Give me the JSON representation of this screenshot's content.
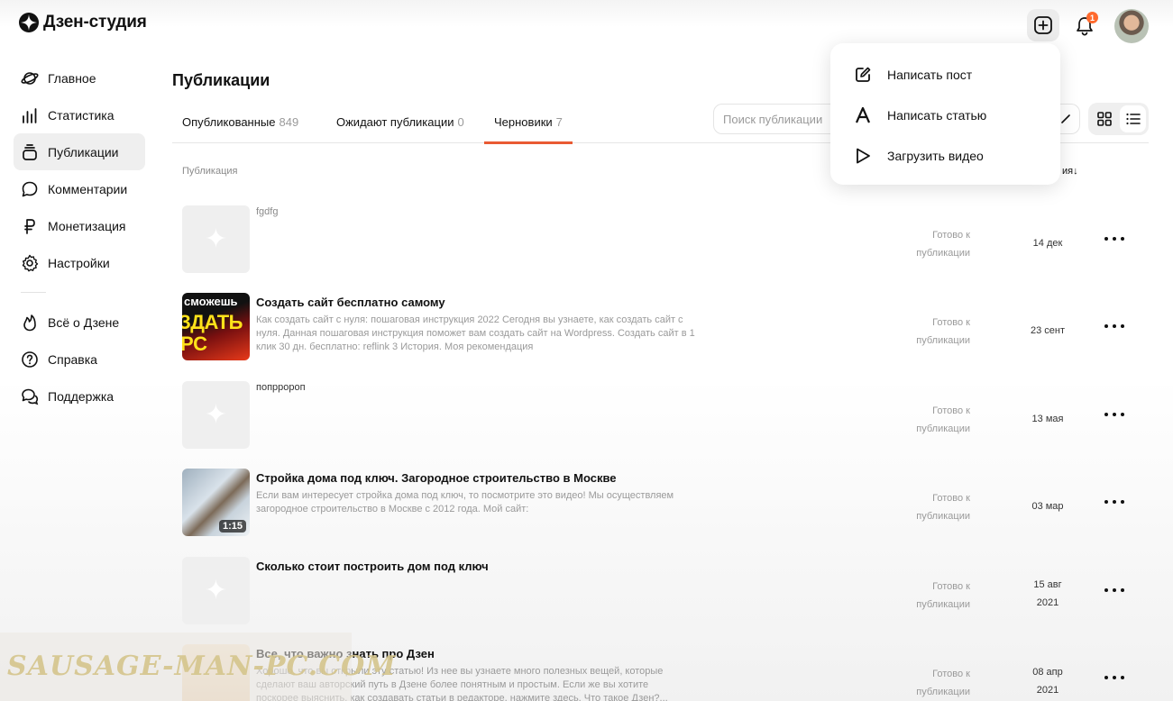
{
  "app": {
    "title": "Дзен-студия"
  },
  "header": {
    "notifications_count": "1"
  },
  "sidebar": {
    "items": [
      {
        "label": "Главное",
        "icon": "planet-icon"
      },
      {
        "label": "Статистика",
        "icon": "bar-chart-icon"
      },
      {
        "label": "Публикации",
        "icon": "stack-icon"
      },
      {
        "label": "Комментарии",
        "icon": "comment-icon"
      },
      {
        "label": "Монетизация",
        "icon": "ruble-icon"
      },
      {
        "label": "Настройки",
        "icon": "gear-icon"
      }
    ],
    "secondary": [
      {
        "label": "Всё о Дзене",
        "icon": "flame-icon"
      },
      {
        "label": "Справка",
        "icon": "question-icon"
      },
      {
        "label": "Поддержка",
        "icon": "chat-bubbles-icon"
      }
    ]
  },
  "main": {
    "title": "Публикации",
    "tabs": [
      {
        "label": "Опубликованные",
        "count": "849"
      },
      {
        "label": "Ожидают публикации",
        "count": "0"
      },
      {
        "label": "Черновики",
        "count": "7"
      }
    ],
    "search_placeholder": "Поиск публикации",
    "columns": {
      "publication": "Публикация",
      "date_fragment": "ия↓"
    },
    "rows": [
      {
        "title": "fgdfg",
        "description": "",
        "status": "Готово к публикации",
        "date": "14 дек"
      },
      {
        "title": "Создать сайт бесплатно самому",
        "description": "Как создать сайт с нуля: пошаговая инструкция 2022 Сегодня вы узнаете, как создать сайт с нуля. Данная пошаговая инструкция поможет вам создать сайт на Wordpress. Создать сайт в 1 клик 30 дн. бесплатно: reflink 3 История. Моя рекомендация",
        "status": "Готово к публикации",
        "date": "23 сент",
        "thumb_text": [
          "сможешь",
          "ЗДАТЬ",
          "РС"
        ]
      },
      {
        "title": "попрророп",
        "description": "",
        "status": "Готово к публикации",
        "date": "13 мая"
      },
      {
        "title": "Стройка дома под ключ. Загородное строительство в Москве",
        "description": "Если вам интересует стройка дома под ключ, то посмотрите это видео! Мы осуществляем загородное строительство в Москве с 2012 года. Мой сайт:",
        "status": "Готово к публикации",
        "date": "03 мар",
        "duration": "1:15"
      },
      {
        "title": "Сколько стоит построить дом под ключ",
        "description": "",
        "status": "Готово к публикации",
        "date_line1": "15 авг",
        "date_line2": "2021"
      },
      {
        "title": "Все, что важно знать про Дзен",
        "description": "Хорошо, что вы открыли эту статью! Из нее вы узнаете много полезных вещей, которые сделают ваш авторский путь в Дзене более понятным и простым. Если же вы хотите поскорее выяснить, как создавать статьи в редакторе, нажмите здесь. Что такое Дзен?...",
        "status": "Готово к публикации",
        "date_line1": "08 апр",
        "date_line2": "2021"
      }
    ]
  },
  "create_menu": {
    "items": [
      {
        "label": "Написать пост",
        "icon": "edit-icon"
      },
      {
        "label": "Написать статью",
        "icon": "letter-a-icon"
      },
      {
        "label": "Загрузить видео",
        "icon": "play-icon"
      }
    ]
  },
  "watermark": {
    "text": "SAUSAGE-MAN-PC.COM"
  },
  "colors": {
    "accent": "#e95a33",
    "badge": "#ff6a2e"
  }
}
